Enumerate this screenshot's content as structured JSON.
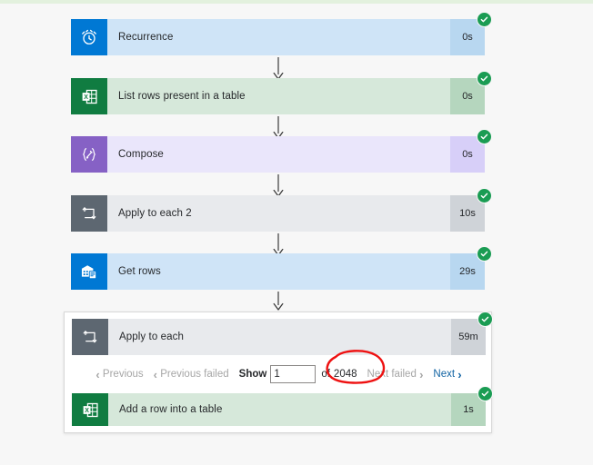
{
  "background": {
    "page_color": "#f7f7f7",
    "top_band_color": "#e3f1de"
  },
  "colors": {
    "status_success": "#1a9c53",
    "link": "#1264a3",
    "disabled_text": "#a6a6a6",
    "annotation_red": "#ee1111",
    "blue_accent": "#0078d4",
    "excel_green": "#107c41",
    "compose_purple": "#8661c5",
    "control_gray": "#5d6771"
  },
  "flow": {
    "steps": [
      {
        "id": "recurrence",
        "title": "Recurrence",
        "duration": "0s",
        "status": "succeeded",
        "icon": "alarm-clock-icon",
        "theme": "blue"
      },
      {
        "id": "list-rows-present-in-a-table",
        "title": "List rows present in a table",
        "duration": "0s",
        "status": "succeeded",
        "icon": "excel-table-icon",
        "theme": "green"
      },
      {
        "id": "compose",
        "title": "Compose",
        "duration": "0s",
        "status": "succeeded",
        "icon": "compose-braces-icon",
        "theme": "purple"
      },
      {
        "id": "apply-to-each-2",
        "title": "Apply to each 2",
        "duration": "10s",
        "status": "succeeded",
        "icon": "foreach-loop-icon",
        "theme": "gray"
      },
      {
        "id": "get-rows",
        "title": "Get rows",
        "duration": "29s",
        "status": "succeeded",
        "icon": "database-rows-icon",
        "theme": "blue"
      }
    ],
    "scope": {
      "header": {
        "id": "apply-to-each",
        "title": "Apply to each",
        "duration": "59m",
        "status": "succeeded",
        "icon": "foreach-loop-icon",
        "theme": "gray"
      },
      "pagination": {
        "previous_label": "Previous",
        "previous_failed_label": "Previous failed",
        "show_label": "Show",
        "page_value": "1",
        "page_placeholder": "1",
        "of_label": "of",
        "total_pages": "2048",
        "next_failed_label": "Next failed",
        "next_label": "Next"
      },
      "nested_steps": [
        {
          "id": "add-a-row-into-a-table",
          "title": "Add a row into a table",
          "duration": "1s",
          "status": "succeeded",
          "icon": "excel-table-icon",
          "theme": "green"
        }
      ]
    }
  },
  "annotation": {
    "type": "hand-drawn-red-ellipse",
    "targets": "2048"
  }
}
